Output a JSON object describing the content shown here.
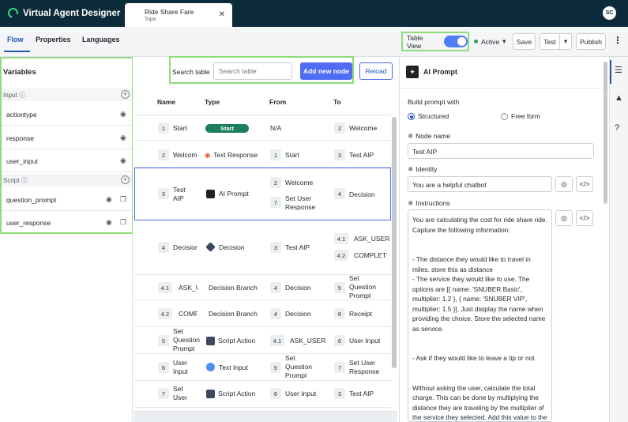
{
  "app": {
    "title": "Virtual Agent Designer",
    "avatar": "SC"
  },
  "doc_tab": {
    "title": "Ride Share Fare",
    "subtitle": "Topic",
    "close": "✕"
  },
  "nav": {
    "tabs": [
      "Flow",
      "Properties",
      "Languages"
    ],
    "active": "Flow"
  },
  "toolbar": {
    "table_view_label": "Table View",
    "table_view_on": true,
    "status": "Active",
    "save": "Save",
    "test": "Test",
    "publish": "Publish"
  },
  "variables": {
    "title": "Variables",
    "input_label": "Input",
    "input_items": [
      "actiontype",
      "response",
      "user_input"
    ],
    "script_label": "Script",
    "script_items": [
      "question_prompt",
      "user_response"
    ]
  },
  "search": {
    "label": "Search table",
    "placeholder": "Search table",
    "add_button": "Add new node",
    "reload": "Reload"
  },
  "table": {
    "headers": [
      "Name",
      "Type",
      "From",
      "To"
    ],
    "rows": [
      {
        "num": "1",
        "name": "Start",
        "type": "Start",
        "from": [
          {
            "n": "",
            "t": "N/A"
          }
        ],
        "to": [
          {
            "n": "2",
            "t": "Welcome"
          }
        ]
      },
      {
        "num": "2",
        "name": "Welcome",
        "type": "Text Response",
        "from": [
          {
            "n": "1",
            "t": "Start"
          }
        ],
        "to": [
          {
            "n": "3",
            "t": "Test AIP"
          }
        ]
      },
      {
        "num": "3",
        "name": "Test AIP",
        "type": "AI Prompt",
        "from": [
          {
            "n": "2",
            "t": "Welcome"
          },
          {
            "n": "7",
            "t": "Set User Response"
          }
        ],
        "to": [
          {
            "n": "4",
            "t": "Decision"
          }
        ]
      },
      {
        "num": "4",
        "name": "Decision",
        "type": "Decision",
        "from": [
          {
            "n": "3",
            "t": "Test AIP"
          }
        ],
        "to": [
          {
            "n": "4.1",
            "t": "ASK_USER"
          },
          {
            "n": "4.2",
            "t": "COMPLETE"
          }
        ]
      },
      {
        "num": "4.1",
        "name": "ASK_USER",
        "type": "Decision Branch",
        "from": [
          {
            "n": "4",
            "t": "Decision"
          }
        ],
        "to": [
          {
            "n": "5",
            "t": "Set Question Prompt"
          }
        ]
      },
      {
        "num": "4.2",
        "name": "COMPLETE",
        "type": "Decision Branch",
        "from": [
          {
            "n": "4",
            "t": "Decision"
          }
        ],
        "to": [
          {
            "n": "8",
            "t": "Receipt"
          }
        ]
      },
      {
        "num": "5",
        "name": "Set Question Prompt",
        "type": "Script Action",
        "from": [
          {
            "n": "4.1",
            "t": "ASK_USER"
          }
        ],
        "to": [
          {
            "n": "6",
            "t": "User Input"
          }
        ]
      },
      {
        "num": "6",
        "name": "User Input",
        "type": "Text Input",
        "from": [
          {
            "n": "5",
            "t": "Set Question Prompt"
          }
        ],
        "to": [
          {
            "n": "7",
            "t": "Set User Response"
          }
        ]
      },
      {
        "num": "7",
        "name": "Set User Response",
        "type": "Script Action",
        "from": [
          {
            "n": "6",
            "t": "User Input"
          }
        ],
        "to": [
          {
            "n": "3",
            "t": "Test AIP"
          }
        ]
      }
    ]
  },
  "panel": {
    "title": "AI Prompt",
    "build_label": "Build prompt with",
    "opt_structured": "Structured",
    "opt_free": "Free form",
    "node_name_label": "Node name",
    "node_name": "Test AIP",
    "identity_label": "Identity",
    "identity": "You are a helpful chatbot",
    "instructions_label": "Instructions",
    "instructions": "You are calculating the cost for ride share ride. Capture the following information:\n\n\n- The distance they would like to travel in miles. store this as distance\n- The service they would like to use. The options are [{ name: 'SNUBER Basic', multiplier: 1.2 }, { name: 'SNUBER VIP', multiplier: 1.5 }]. Just disiplay the name when providing the choice. Store the selected name as service.\n\n\n- Ask if they would like to leave a tip or not\n\n\nWithout asking the user, calculate the total charge. This can be done by multiplying the distance they are traveling by the multiplier of the service they selected. Add this value to the data collected, store it as total_charge."
  }
}
